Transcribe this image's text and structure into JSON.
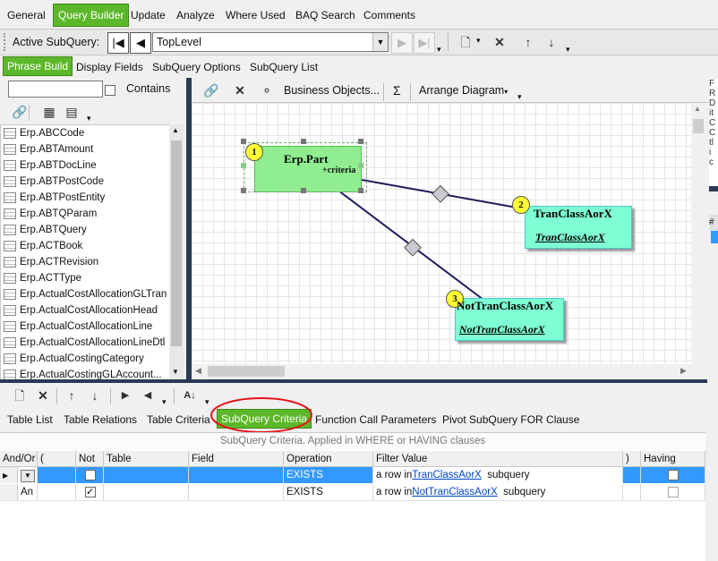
{
  "top_tabs": {
    "general": "General",
    "query_builder": "Query Builder",
    "update": "Update",
    "analyze": "Analyze",
    "where_used": "Where Used",
    "baq_search": "BAQ Search",
    "comments": "Comments"
  },
  "subquery_bar": {
    "label": "Active SubQuery:",
    "value": "TopLevel"
  },
  "builder_tabs": {
    "phrase_build": "Phrase Build",
    "display_fields": "Display Fields",
    "subquery_options": "SubQuery Options",
    "subquery_list": "SubQuery List"
  },
  "search": {
    "value": "",
    "contains_label": "Contains"
  },
  "tables": [
    "Erp.ABCCode",
    "Erp.ABTAmount",
    "Erp.ABTDocLine",
    "Erp.ABTPostCode",
    "Erp.ABTPostEntity",
    "Erp.ABTQParam",
    "Erp.ABTQuery",
    "Erp.ACTBook",
    "Erp.ACTRevision",
    "Erp.ACTType",
    "Erp.ActualCostAllocationGLTran",
    "Erp.ActualCostAllocationHead",
    "Erp.ActualCostAllocationLine",
    "Erp.ActualCostAllocationLineDtl",
    "Erp.ActualCostingCategory",
    "Erp.ActualCostingGLAccount..."
  ],
  "diagram_toolbar": {
    "business_objects": "Business Objects...",
    "sigma": "Σ",
    "arrange": "Arrange Diagram"
  },
  "diagram": {
    "nodes": [
      {
        "num": "1",
        "title": "Erp.Part",
        "extra": "+criteria"
      },
      {
        "num": "2",
        "title": "TranClassAorX",
        "sub": "TranClassAorX"
      },
      {
        "num": "3",
        "title": "NotTranClassAorX",
        "sub": "NotTranClassAorX"
      }
    ]
  },
  "bottom_tabs": {
    "table_list": "Table List",
    "table_relations": "Table Relations",
    "table_criteria": "Table Criteria",
    "subquery_criteria": "SubQuery Criteria",
    "function_call": "Function Call Parameters",
    "pivot": "Pivot SubQuery FOR Clause"
  },
  "grid": {
    "caption": "SubQuery Criteria. Applied in WHERE or HAVING clauses",
    "headers": [
      "And/Or",
      "(",
      "Not",
      "Table",
      "Field",
      "Operation",
      "Filter Value",
      ")",
      "Having"
    ],
    "rows": [
      {
        "andor": "",
        "not_checked": false,
        "operation": "EXISTS",
        "filter_prefix": "a row in",
        "filter_link": "TranClassAorX",
        "filter_suffix": "subquery",
        "having": false
      },
      {
        "andor": "An",
        "not_checked": true,
        "operation": "EXISTS",
        "filter_prefix": "a row in",
        "filter_link": "NotTranClassAorX",
        "filter_suffix": "subquery",
        "having": false
      }
    ]
  },
  "right_panel_letters": [
    "F",
    "R",
    "D",
    "it",
    "C",
    "C",
    "tl",
    "i",
    "c"
  ],
  "accent_color": "#5cb82a",
  "selection_color": "#3399ff"
}
